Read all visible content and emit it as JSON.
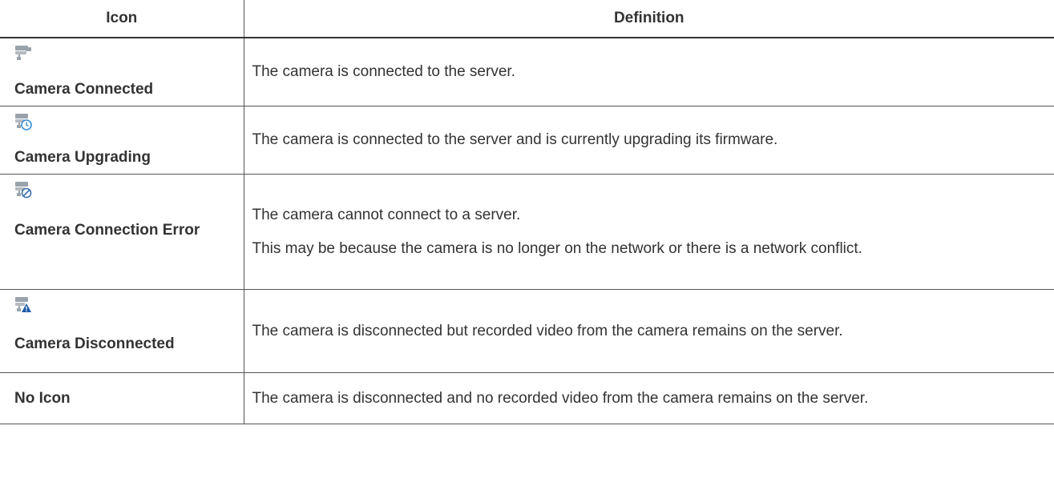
{
  "table": {
    "headers": {
      "icon": "Icon",
      "definition": "Definition"
    },
    "rows": [
      {
        "icon": "camera-connected-icon",
        "label": "Camera Connected",
        "definition": [
          "The camera is connected to the server."
        ]
      },
      {
        "icon": "camera-upgrading-icon",
        "label": "Camera Upgrading",
        "definition": [
          "The camera is connected to the server and is currently upgrading its firmware."
        ]
      },
      {
        "icon": "camera-connection-error-icon",
        "label": "Camera Connection Error",
        "definition": [
          "The camera cannot connect to a server.",
          "This may be because the camera is no longer on the network or there is a network conflict."
        ]
      },
      {
        "icon": "camera-disconnected-icon",
        "label": "Camera Disconnected",
        "definition": [
          "The camera is disconnected but recorded video from the camera remains on the server."
        ]
      },
      {
        "icon": "",
        "label": "No Icon",
        "definition": [
          "The camera is disconnected and no recorded video from the camera remains on the server."
        ]
      }
    ]
  },
  "colors": {
    "text": "#333333",
    "camera_body": "#9aa3ab",
    "clock_badge": "#3a8fd4",
    "error_badge": "#3a6fb0",
    "warning_badge": "#1e5aa8"
  }
}
